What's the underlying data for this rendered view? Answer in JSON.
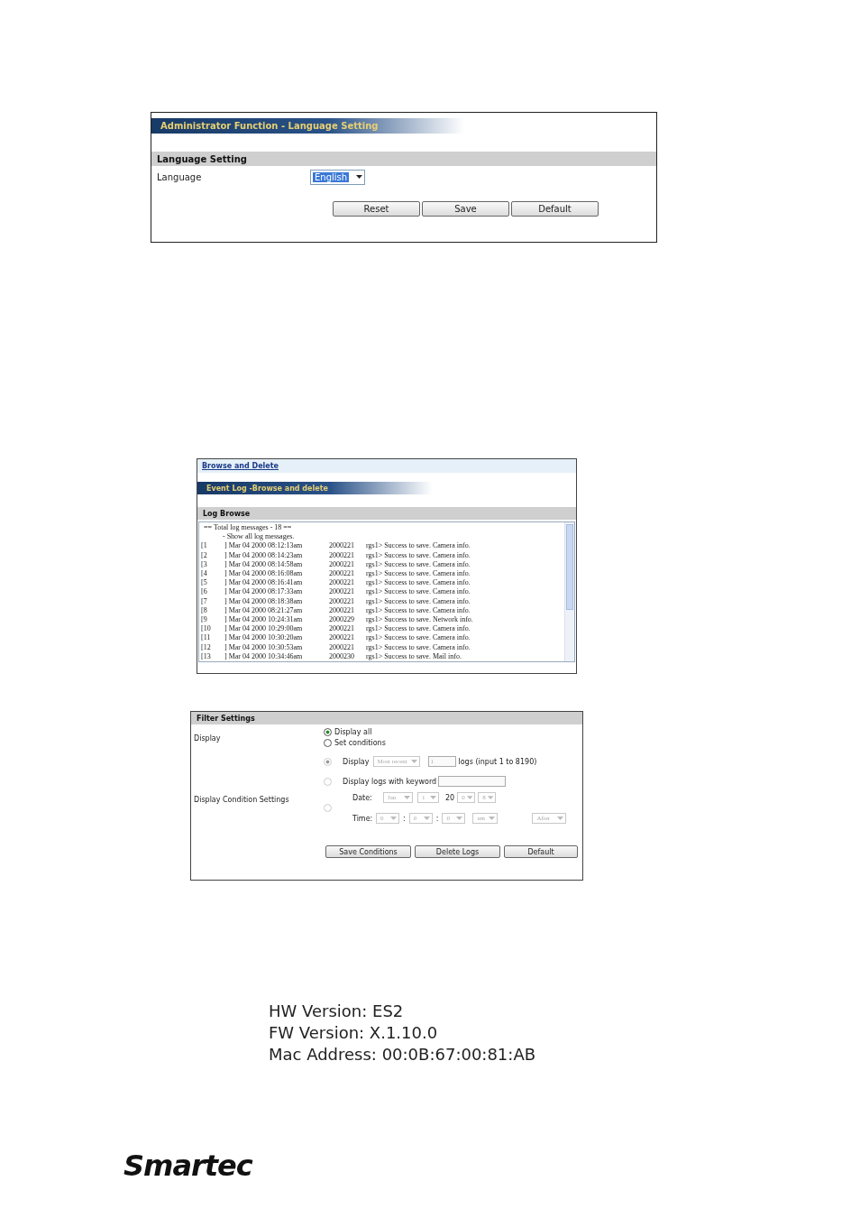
{
  "language_panel": {
    "title": "Administrator Function - Language Setting",
    "section": "Language Setting",
    "field_label": "Language",
    "select": {
      "value": "English",
      "highlighted": true
    },
    "buttons": [
      "Reset",
      "Save",
      "Default"
    ]
  },
  "log_panel": {
    "tab": "Browse and Delete",
    "title": "Event Log -Browse and delete",
    "section": "Log Browse",
    "header_lines": [
      "== Total log messages - 18 ==",
      "- Show all log messages."
    ],
    "rows": [
      {
        "index": "[1",
        "date": "] Mar 04 2000 08:12:13am",
        "code": "2000221",
        "message": "rgs1> Success to save. Camera info."
      },
      {
        "index": "[2",
        "date": "] Mar 04 2000 08:14:23am",
        "code": "2000221",
        "message": "rgs1> Success to save. Camera info."
      },
      {
        "index": "[3",
        "date": "] Mar 04 2000 08:14:58am",
        "code": "2000221",
        "message": "rgs1> Success to save. Camera info."
      },
      {
        "index": "[4",
        "date": "] Mar 04 2000 08:16:08am",
        "code": "2000221",
        "message": "rgs1> Success to save. Camera info."
      },
      {
        "index": "[5",
        "date": "] Mar 04 2000 08:16:41am",
        "code": "2000221",
        "message": "rgs1> Success to save. Camera info."
      },
      {
        "index": "[6",
        "date": "] Mar 04 2000 08:17:33am",
        "code": "2000221",
        "message": "rgs1> Success to save. Camera info."
      },
      {
        "index": "[7",
        "date": "] Mar 04 2000 08:18:38am",
        "code": "2000221",
        "message": "rgs1> Success to save. Camera info."
      },
      {
        "index": "[8",
        "date": "] Mar 04 2000 08:21:27am",
        "code": "2000221",
        "message": "rgs1> Success to save. Camera info."
      },
      {
        "index": "[9",
        "date": "] Mar 04 2000 10:24:31am",
        "code": "2000229",
        "message": "rgs1> Success to save. Network info."
      },
      {
        "index": "[10",
        "date": "] Mar 04 2000 10:29:00am",
        "code": "2000221",
        "message": "rgs1> Success to save. Camera info."
      },
      {
        "index": "[11",
        "date": "] Mar 04 2000 10:30:20am",
        "code": "2000221",
        "message": "rgs1> Success to save. Camera info."
      },
      {
        "index": "[12",
        "date": "] Mar 04 2000 10:30:53am",
        "code": "2000221",
        "message": "rgs1> Success to save. Camera info."
      },
      {
        "index": "[13",
        "date": "] Mar 04 2000 10:34:46am",
        "code": "2000230",
        "message": "rgs1> Success to save. Mail info."
      }
    ]
  },
  "filter_panel": {
    "section": "Filter Settings",
    "display_label": "Display",
    "display_options": [
      {
        "label": "Display all",
        "selected": true
      },
      {
        "label": "Set conditions",
        "selected": false
      }
    ],
    "conditions_label": "Display Condition Settings",
    "conditions_disabled": true,
    "count_row": {
      "selected": true,
      "label": "Display",
      "select": "Most recent",
      "input": "1",
      "suffix": "logs (input 1 to 8190)"
    },
    "keyword_row": {
      "selected": false,
      "label": "Display logs with keyword"
    },
    "date_row": {
      "selected": false,
      "date_label": "Date:",
      "month": "Jan",
      "day": "1",
      "year_prefix": "20",
      "year_tens": "0",
      "year_ones": "8",
      "time_label": "Time:",
      "hour": "0",
      "separators": [
        ":",
        ":"
      ],
      "minute": "0",
      "second": "0",
      "ampm": "am",
      "order": "After"
    },
    "buttons": [
      "Save Conditions",
      "Delete Logs",
      "Default"
    ]
  },
  "versions": [
    "HW Version: ES2",
    "FW Version: X.1.10.0",
    "Mac Address: 00:0B:67:00:81:AB"
  ],
  "logo": "Smartec"
}
